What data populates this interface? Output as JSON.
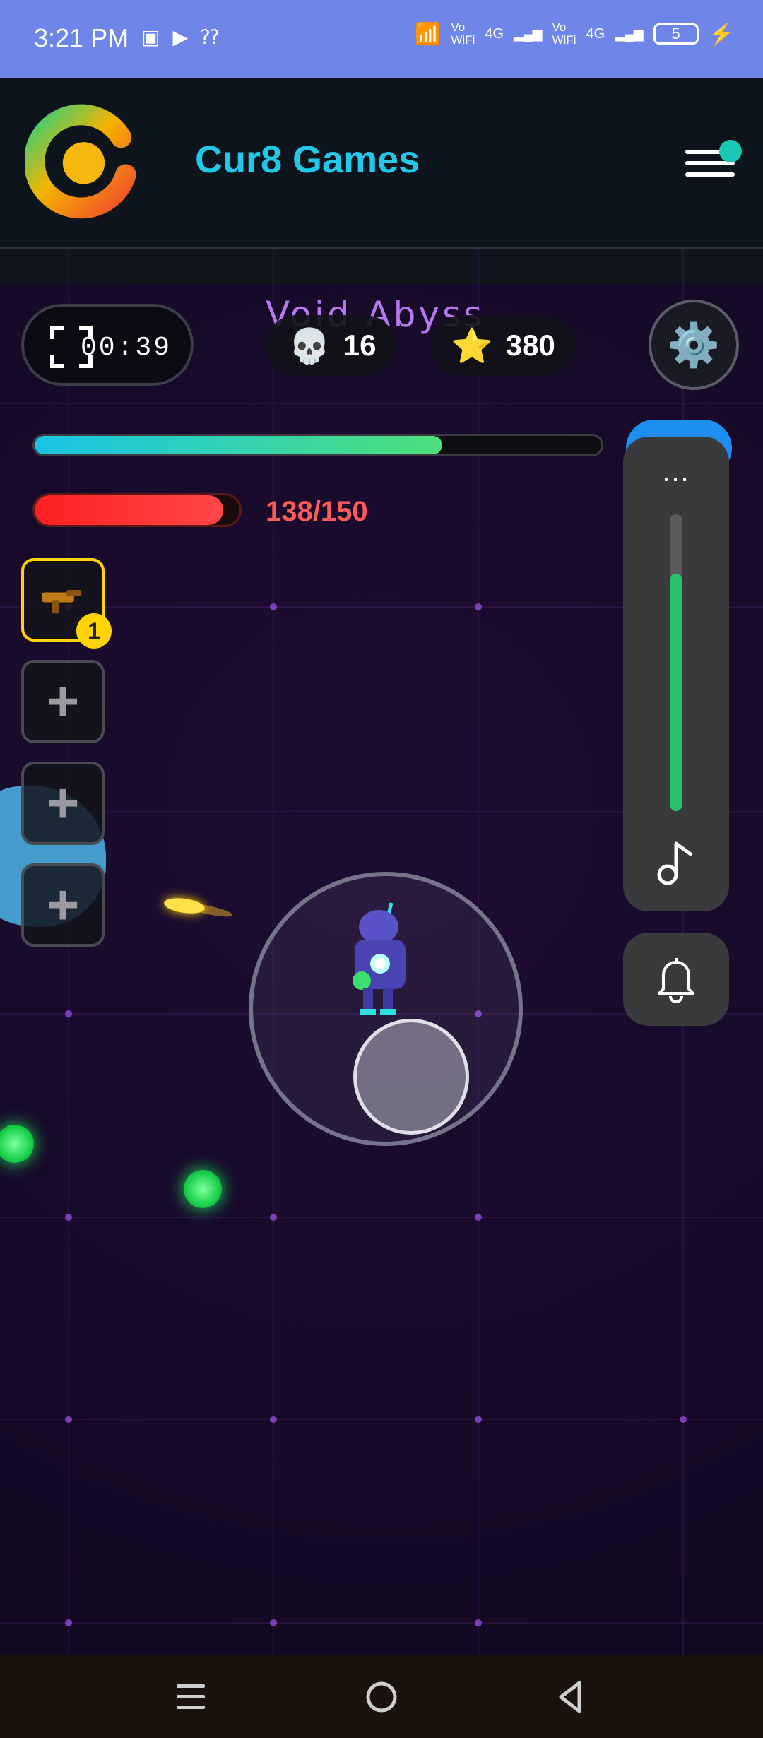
{
  "status_bar": {
    "time": "3:21 PM",
    "vowifi_1": "Vo\nWiFi",
    "net_1": "4G",
    "vowifi_2": "Vo\nWiFi",
    "net_2": "4G",
    "battery_level": "5"
  },
  "app_header": {
    "brand": "Cur8 Games"
  },
  "game": {
    "level_title": "Void Abyss",
    "timer": "00:39",
    "kills": "16",
    "stars": "380",
    "xp_progress": 0.72,
    "hp_progress": 0.92,
    "hp_text": "138/150",
    "weapon_slots": [
      {
        "label": "",
        "count": "1",
        "active": true
      },
      {
        "label": "+",
        "active": false
      },
      {
        "label": "+",
        "active": false
      },
      {
        "label": "+",
        "active": false
      }
    ]
  },
  "media_panel": {
    "more_label": "...",
    "volume_level": 0.8
  },
  "colors": {
    "accent": "#21c8ea",
    "xp_start": "#19c4e6",
    "xp_end": "#4de07a",
    "hp": "#ff2020",
    "active_slot": "#ffd400",
    "volume": "#25c26a"
  },
  "icons": {
    "timer": "focus-frame-icon",
    "kills": "skull-icon",
    "stars": "star-icon",
    "settings": "gear-icon",
    "menu": "hamburger-menu-icon",
    "music": "music-note-icon",
    "notification": "bell-icon",
    "nav": [
      "recent-apps-icon",
      "home-icon",
      "back-icon"
    ]
  }
}
